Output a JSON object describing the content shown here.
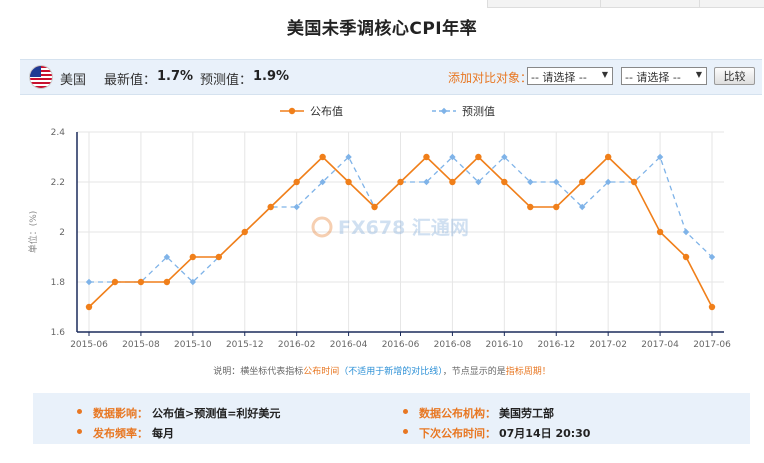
{
  "title": "美国未季调核心CPI年率",
  "info": {
    "country": "美国",
    "latest_label": "最新值：",
    "latest_value": "1.7%",
    "forecast_label": "预测值：",
    "forecast_value": "1.9%",
    "compare_label": "添加对比对象：",
    "select1": "-- 请选择 --",
    "select2": "-- 请选择 --",
    "compare_button": "比较"
  },
  "colors": {
    "actual": "#f07f1a",
    "forecast": "#7fb3e8",
    "accent": "#e87722",
    "info_bg": "#e9f1fa"
  },
  "chart_data": {
    "type": "line",
    "title": "",
    "ylabel": "单位：(%)",
    "ylim": [
      1.6,
      2.4
    ],
    "yticks": [
      "2.4",
      "2.2",
      "2",
      "1.8",
      "1.6"
    ],
    "x": [
      "2015-06",
      "2015-07",
      "2015-08",
      "2015-09",
      "2015-10",
      "2015-11",
      "2015-12",
      "2016-01",
      "2016-02",
      "2016-03",
      "2016-04",
      "2016-05",
      "2016-06",
      "2016-07",
      "2016-08",
      "2016-09",
      "2016-10",
      "2016-11",
      "2016-12",
      "2017-01",
      "2017-02",
      "2017-03",
      "2017-04",
      "2017-05",
      "2017-06"
    ],
    "xticks": [
      "2015-06",
      "2015-08",
      "2015-10",
      "2015-12",
      "2016-02",
      "2016-04",
      "2016-06",
      "2016-08",
      "2016-10",
      "2016-12",
      "2017-02",
      "2017-04",
      "2017-06"
    ],
    "grid": true,
    "legend_position": "top-center",
    "series": [
      {
        "name": "公布值",
        "style": "solid",
        "values": [
          1.7,
          1.8,
          1.8,
          1.8,
          1.9,
          1.9,
          2.0,
          2.1,
          2.2,
          2.3,
          2.2,
          2.1,
          2.2,
          2.3,
          2.2,
          2.3,
          2.2,
          2.1,
          2.1,
          2.2,
          2.3,
          2.2,
          2.0,
          1.9,
          1.7
        ]
      },
      {
        "name": "预测值",
        "style": "dashed",
        "values": [
          1.8,
          1.8,
          1.8,
          1.9,
          1.8,
          1.9,
          2.0,
          2.1,
          2.1,
          2.2,
          2.3,
          2.1,
          2.2,
          2.2,
          2.3,
          2.2,
          2.3,
          2.2,
          2.2,
          2.1,
          2.2,
          2.2,
          2.3,
          2.0,
          1.9
        ]
      }
    ],
    "watermark": "FX678 汇通网"
  },
  "note": {
    "prefix": "说明：横坐标代表指标",
    "highlight1": "公布时间",
    "paren": "（不适用于新增的对比线）",
    "middle": "，节点显示的是",
    "highlight2": "指标周期",
    "suffix": "！"
  },
  "details": {
    "impact_label": "数据影响：",
    "impact_value": "公布值>预测值=利好美元",
    "freq_label": "发布频率：",
    "freq_value": "每月",
    "agency_label": "数据公布机构：",
    "agency_value": "美国劳工部",
    "next_label": "下次公布时间：",
    "next_value": "07月14日 20:30"
  }
}
